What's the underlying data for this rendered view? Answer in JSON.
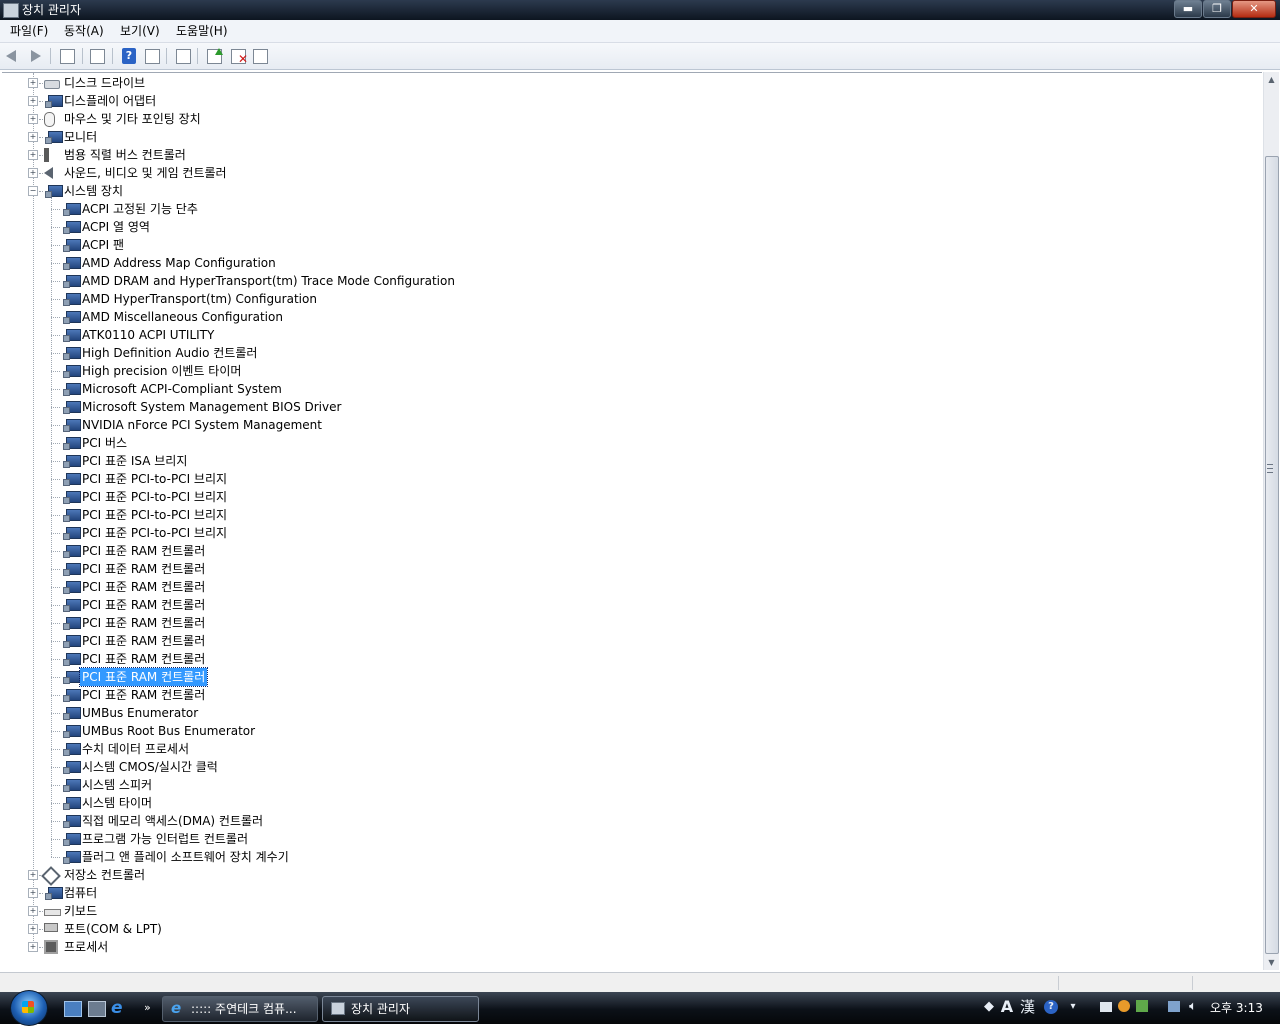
{
  "window": {
    "title": "장치 관리자",
    "min_symbol": "▬",
    "max_symbol": "❐",
    "close_symbol": "✕"
  },
  "menu": {
    "items": [
      {
        "label": "파일(F)"
      },
      {
        "label": "동작(A)"
      },
      {
        "label": "보기(V)"
      },
      {
        "label": "도움말(H)"
      }
    ]
  },
  "toolbar": {
    "buttons": [
      {
        "icon": "back-arrow-icon"
      },
      {
        "icon": "forward-arrow-icon"
      },
      {
        "icon": "console-tree-icon"
      },
      {
        "icon": "properties-icon"
      },
      {
        "icon": "help-icon",
        "glyph": "?"
      },
      {
        "icon": "show-hide-icon"
      },
      {
        "icon": "scan-hardware-icon"
      },
      {
        "icon": "update-driver-icon"
      },
      {
        "icon": "uninstall-icon",
        "glyph": "✕"
      },
      {
        "icon": "disable-icon"
      }
    ]
  },
  "tree": {
    "rows": [
      {
        "label": "디스크 드라이브",
        "icon": "disk-drive-icon",
        "level": 0,
        "expander": "+"
      },
      {
        "label": "디스플레이 어댑터",
        "icon": "display-adapter-icon",
        "level": 0,
        "expander": "+"
      },
      {
        "label": "마우스 및 기타 포인팅 장치",
        "icon": "mouse-icon",
        "level": 0,
        "expander": "+"
      },
      {
        "label": "모니터",
        "icon": "monitor-icon",
        "level": 0,
        "expander": "+"
      },
      {
        "label": "범용 직렬 버스 컨트롤러",
        "icon": "usb-icon",
        "level": 0,
        "expander": "+"
      },
      {
        "label": "사운드, 비디오 및 게임 컨트롤러",
        "icon": "speaker-icon",
        "level": 0,
        "expander": "+"
      },
      {
        "label": "시스템 장치",
        "icon": "system-device-icon",
        "level": 0,
        "expander": "−"
      },
      {
        "label": "ACPI 고정된 기능 단추",
        "icon": "system-device-icon",
        "level": 1
      },
      {
        "label": "ACPI 열 영역",
        "icon": "system-device-icon",
        "level": 1
      },
      {
        "label": "ACPI 팬",
        "icon": "system-device-icon",
        "level": 1
      },
      {
        "label": "AMD Address Map Configuration",
        "icon": "system-device-icon",
        "level": 1
      },
      {
        "label": "AMD DRAM and HyperTransport(tm) Trace Mode Configuration",
        "icon": "system-device-icon",
        "level": 1
      },
      {
        "label": "AMD HyperTransport(tm) Configuration",
        "icon": "system-device-icon",
        "level": 1
      },
      {
        "label": "AMD Miscellaneous Configuration",
        "icon": "system-device-icon",
        "level": 1
      },
      {
        "label": "ATK0110 ACPI UTILITY",
        "icon": "system-device-icon",
        "level": 1
      },
      {
        "label": "High Definition Audio 컨트롤러",
        "icon": "system-device-icon",
        "level": 1
      },
      {
        "label": "High precision 이벤트 타이머",
        "icon": "system-device-icon",
        "level": 1
      },
      {
        "label": "Microsoft ACPI-Compliant System",
        "icon": "system-device-icon",
        "level": 1
      },
      {
        "label": "Microsoft System Management BIOS Driver",
        "icon": "system-device-icon",
        "level": 1
      },
      {
        "label": "NVIDIA nForce PCI System Management",
        "icon": "system-device-icon",
        "level": 1
      },
      {
        "label": "PCI 버스",
        "icon": "system-device-icon",
        "level": 1
      },
      {
        "label": "PCI 표준 ISA 브리지",
        "icon": "system-device-icon",
        "level": 1
      },
      {
        "label": "PCI 표준 PCI-to-PCI 브리지",
        "icon": "system-device-icon",
        "level": 1
      },
      {
        "label": "PCI 표준 PCI-to-PCI 브리지",
        "icon": "system-device-icon",
        "level": 1
      },
      {
        "label": "PCI 표준 PCI-to-PCI 브리지",
        "icon": "system-device-icon",
        "level": 1
      },
      {
        "label": "PCI 표준 PCI-to-PCI 브리지",
        "icon": "system-device-icon",
        "level": 1
      },
      {
        "label": "PCI 표준 RAM 컨트롤러",
        "icon": "system-device-icon",
        "level": 1
      },
      {
        "label": "PCI 표준 RAM 컨트롤러",
        "icon": "system-device-icon",
        "level": 1
      },
      {
        "label": "PCI 표준 RAM 컨트롤러",
        "icon": "system-device-icon",
        "level": 1
      },
      {
        "label": "PCI 표준 RAM 컨트롤러",
        "icon": "system-device-icon",
        "level": 1
      },
      {
        "label": "PCI 표준 RAM 컨트롤러",
        "icon": "system-device-icon",
        "level": 1
      },
      {
        "label": "PCI 표준 RAM 컨트롤러",
        "icon": "system-device-icon",
        "level": 1
      },
      {
        "label": "PCI 표준 RAM 컨트롤러",
        "icon": "system-device-icon",
        "level": 1
      },
      {
        "label": "PCI 표준 RAM 컨트롤러",
        "icon": "system-device-icon",
        "level": 1,
        "selected": true
      },
      {
        "label": "PCI 표준 RAM 컨트롤러",
        "icon": "system-device-icon",
        "level": 1
      },
      {
        "label": "UMBus Enumerator",
        "icon": "system-device-icon",
        "level": 1
      },
      {
        "label": "UMBus Root Bus Enumerator",
        "icon": "system-device-icon",
        "level": 1
      },
      {
        "label": "수치 데이터 프로세서",
        "icon": "system-device-icon",
        "level": 1
      },
      {
        "label": "시스템 CMOS/실시간 클럭",
        "icon": "system-device-icon",
        "level": 1
      },
      {
        "label": "시스템 스피커",
        "icon": "system-device-icon",
        "level": 1
      },
      {
        "label": "시스템 타이머",
        "icon": "system-device-icon",
        "level": 1
      },
      {
        "label": "직접 메모리 액세스(DMA) 컨트롤러",
        "icon": "system-device-icon",
        "level": 1
      },
      {
        "label": "프로그램 가능 인터럽트 컨트롤러",
        "icon": "system-device-icon",
        "level": 1
      },
      {
        "label": "플러그 앤 플레이 소프트웨어 장치 계수기",
        "icon": "system-device-icon",
        "level": 1
      },
      {
        "label": "저장소 컨트롤러",
        "icon": "storage-controller-icon",
        "level": 0,
        "expander": "+"
      },
      {
        "label": "컴퓨터",
        "icon": "computer-icon",
        "level": 0,
        "expander": "+"
      },
      {
        "label": "키보드",
        "icon": "keyboard-icon",
        "level": 0,
        "expander": "+"
      },
      {
        "label": "포트(COM & LPT)",
        "icon": "port-icon",
        "level": 0,
        "expander": "+"
      },
      {
        "label": "프로세서",
        "icon": "processor-icon",
        "level": 0,
        "expander": "+"
      }
    ]
  },
  "scrollbar": {
    "up_arrow": "▲",
    "down_arrow": "▼"
  },
  "taskbar": {
    "quick_launch_more": "»",
    "tasks": [
      {
        "label": "::::: 주연테크 컴퓨...",
        "icon": "ie-icon",
        "glyph": "e"
      },
      {
        "label": "장치 관리자",
        "icon": "device-manager-icon"
      }
    ],
    "tray": {
      "ime_a": "A",
      "ime_hanja": "漢",
      "help": "?",
      "clock": "오후 3:13"
    }
  },
  "colors": {
    "selection": "#3399ff",
    "titlebar": "#1b2534",
    "taskbar": "#0c1118"
  }
}
